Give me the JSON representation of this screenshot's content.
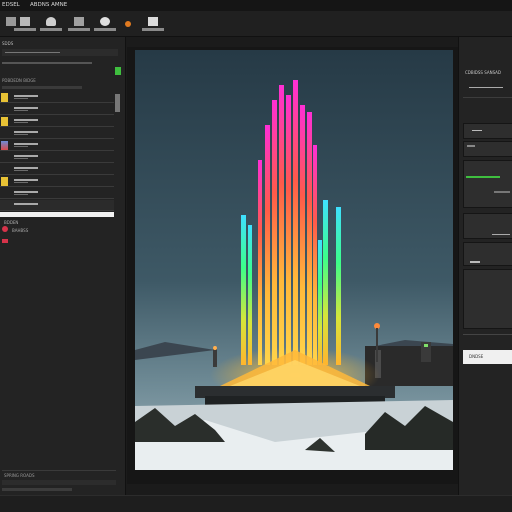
{
  "titlebar": {
    "menu_1": "EDSEL",
    "menu_2": "ABDNS AMNE"
  },
  "toolbar": {
    "tools": [
      {
        "icon": "select-icon"
      },
      {
        "icon": "layers-icon"
      },
      {
        "icon": "brush-icon"
      },
      {
        "icon": "palette-icon"
      },
      {
        "icon": "cloud-icon"
      },
      {
        "icon": "color-dot-icon"
      },
      {
        "icon": "monitor-icon"
      }
    ]
  },
  "left_panel": {
    "header_label": "SDDS",
    "subheader_label": "PDBDEDN BIDGE",
    "context_label": "BDDEN",
    "context_label_2": "BAHBSS",
    "footer_label": "SPRING ROADS"
  },
  "right_panel": {
    "header_label": "CDBIDSS SANSAD",
    "button_label": "DNDSE"
  },
  "colors": {
    "panel": "#232323",
    "accent_green": "#3fbf3f",
    "accent_red": "#d6334a",
    "selection": "#f2f2f2",
    "sky_top": "#263a46",
    "sky_bottom": "#5e7a86"
  }
}
